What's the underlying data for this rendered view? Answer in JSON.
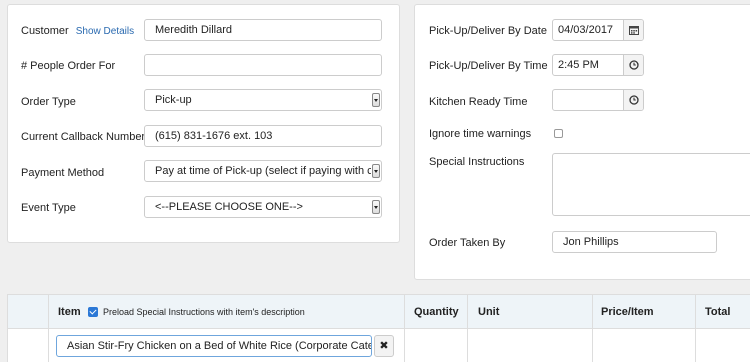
{
  "left": {
    "customer_label": "Customer",
    "show_details": "Show Details",
    "customer_value": "Meredith Dillard",
    "people_label": "# People Order For",
    "people_value": "",
    "order_type_label": "Order Type",
    "order_type_value": "Pick-up",
    "callback_label": "Current Callback Number",
    "callback_value": "(615) 831-1676 ext. 103",
    "payment_label": "Payment Method",
    "payment_value": "Pay at time of Pick-up (select if paying with ca",
    "event_label": "Event Type",
    "event_value": "<--PLEASE CHOOSE ONE-->"
  },
  "right": {
    "date_label": "Pick-Up/Deliver By Date",
    "date_value": "04/03/2017",
    "time_label": "Pick-Up/Deliver By Time",
    "time_value": "2:45 PM",
    "kitchen_label": "Kitchen Ready Time",
    "kitchen_value": "",
    "ignore_label": "Ignore time warnings",
    "special_label": "Special Instructions",
    "special_value": "",
    "taken_label": "Order Taken By",
    "taken_value": "Jon Phillips"
  },
  "table": {
    "item_header": "Item",
    "preload_label": "Preload Special Instructions with item's description",
    "quantity_header": "Quantity",
    "unit_header": "Unit",
    "price_header": "Price/Item",
    "total_header": "Total",
    "item_value": "Asian Stir-Fry Chicken on a Bed of White Rice (Corporate Caterin",
    "remove_glyph": "✖"
  }
}
